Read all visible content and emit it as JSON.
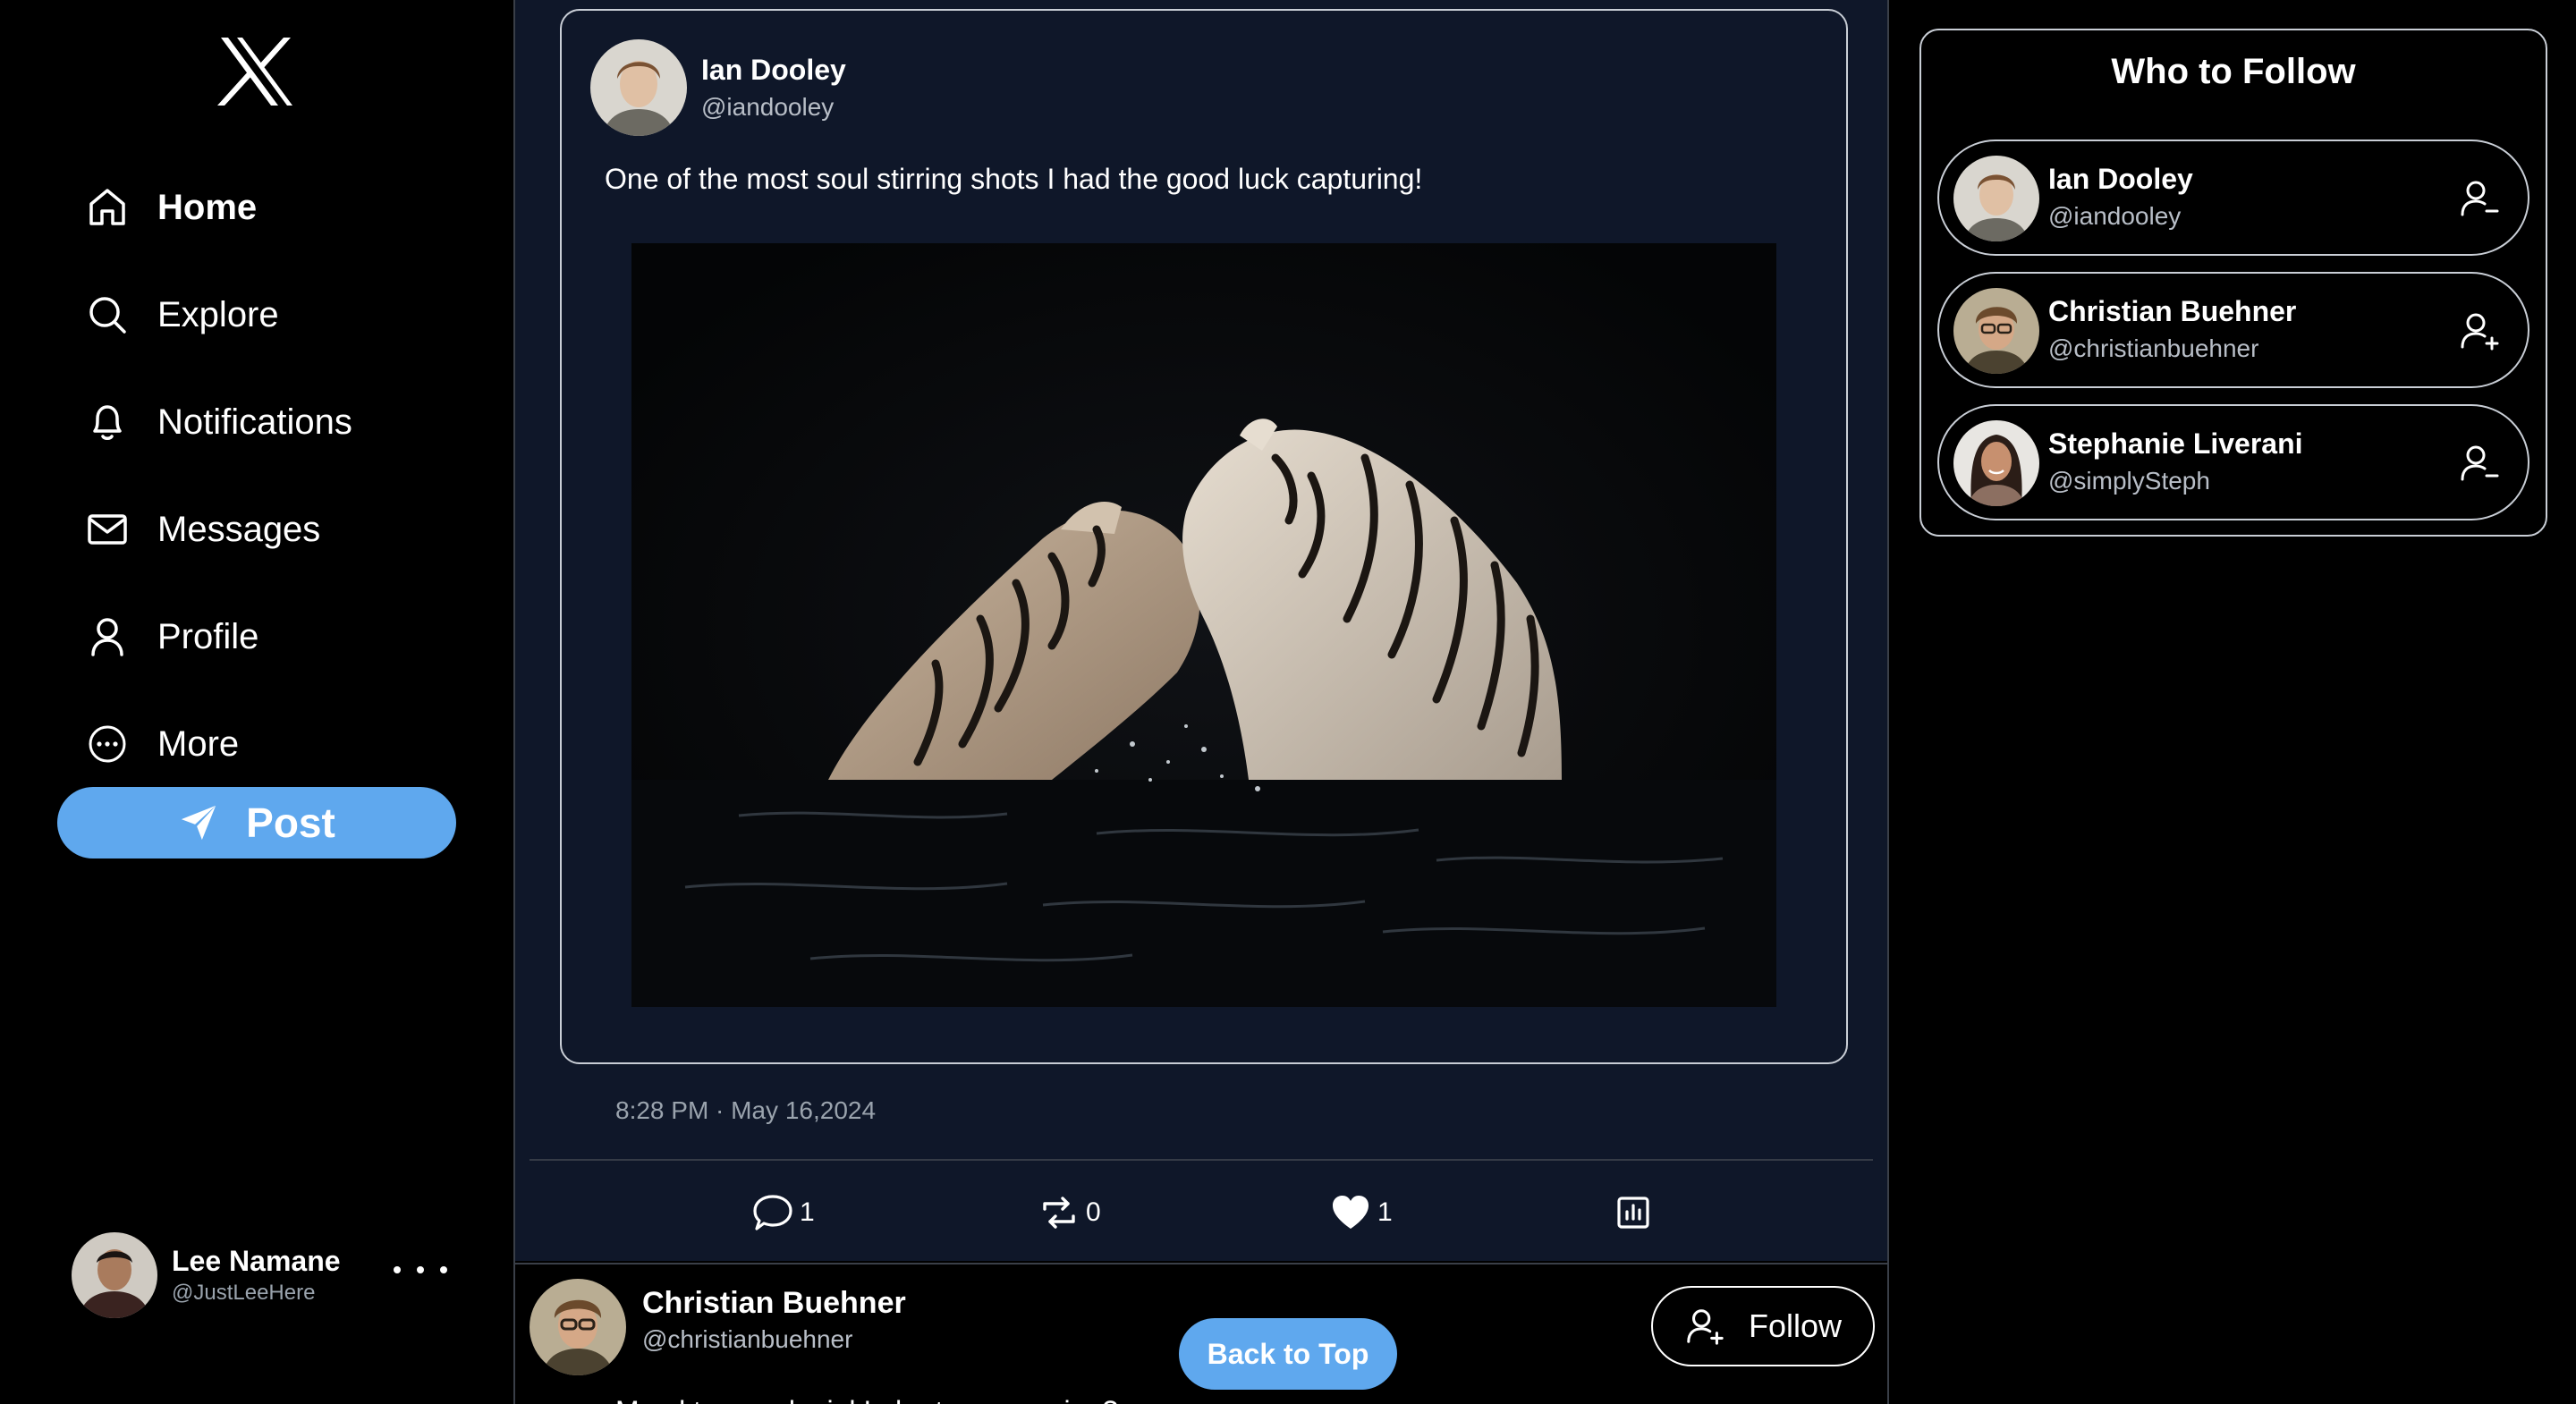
{
  "sidebar": {
    "nav": [
      {
        "label": "Home",
        "icon": "home-icon",
        "active": true
      },
      {
        "label": "Explore",
        "icon": "search-icon",
        "active": false
      },
      {
        "label": "Notifications",
        "icon": "bell-icon",
        "active": false
      },
      {
        "label": "Messages",
        "icon": "mail-icon",
        "active": false
      },
      {
        "label": "Profile",
        "icon": "user-icon",
        "active": false
      },
      {
        "label": "More",
        "icon": "more-circle-icon",
        "active": false
      }
    ],
    "post_label": "Post",
    "account": {
      "name": "Lee Namane",
      "handle": "@JustLeeHere"
    }
  },
  "tweet": {
    "author": {
      "name": "Ian Dooley",
      "handle": "@iandooley"
    },
    "text": "One of the most soul stirring shots I had the good luck capturing!",
    "timestamp": "8:28 PM · May 16,2024",
    "stats": {
      "replies": "1",
      "retweets": "0",
      "likes": "1"
    }
  },
  "next_tweet": {
    "author": {
      "name": "Christian Buehner",
      "handle": "@christianbuehner"
    },
    "follow_label": "Follow",
    "text_partial": "Mo...l ta...e ...k...i..l I...h...t...e ...e...ring?"
  },
  "back_to_top_label": "Back to Top",
  "who_to_follow": {
    "title": "Who to Follow",
    "items": [
      {
        "name": "Ian Dooley",
        "handle": "@iandooley",
        "icon": "unfollow-user-icon"
      },
      {
        "name": "Christian Buehner",
        "handle": "@christianbuehner",
        "icon": "follow-user-icon"
      },
      {
        "name": "Stephanie Liverani",
        "handle": "@simplySteph",
        "icon": "unfollow-user-icon"
      }
    ]
  },
  "colors": {
    "accent": "#5fa8ee",
    "background": "#000000",
    "thread_background": "#0f1729",
    "border": "#c9ced6",
    "muted_text": "#9aa3ad"
  }
}
